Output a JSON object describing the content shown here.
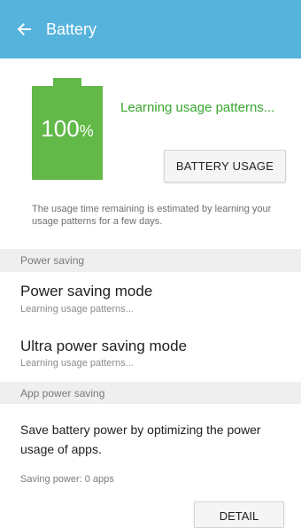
{
  "appbar": {
    "title": "Battery",
    "back_icon": "arrow-left-icon",
    "background_color": "#56b4dc"
  },
  "battery": {
    "level_percent": 100,
    "level_number": "100",
    "percent_sign": "%",
    "fill_color": "#62b948",
    "status": "Learning usage patterns...",
    "status_color": "#38a62f",
    "usage_button_label": "BATTERY USAGE",
    "note": "The usage time remaining is estimated by learning your usage patterns for a few days."
  },
  "power_saving": {
    "header": "Power saving",
    "items": [
      {
        "title": "Power saving mode",
        "subtitle": "Learning usage patterns..."
      },
      {
        "title": "Ultra power saving mode",
        "subtitle": "Learning usage patterns..."
      }
    ]
  },
  "app_power_saving": {
    "header": "App power saving",
    "description": "Save battery power by optimizing the power usage of apps.",
    "saving_status": "Saving power: 0 apps",
    "detail_button_label": "DETAIL"
  }
}
